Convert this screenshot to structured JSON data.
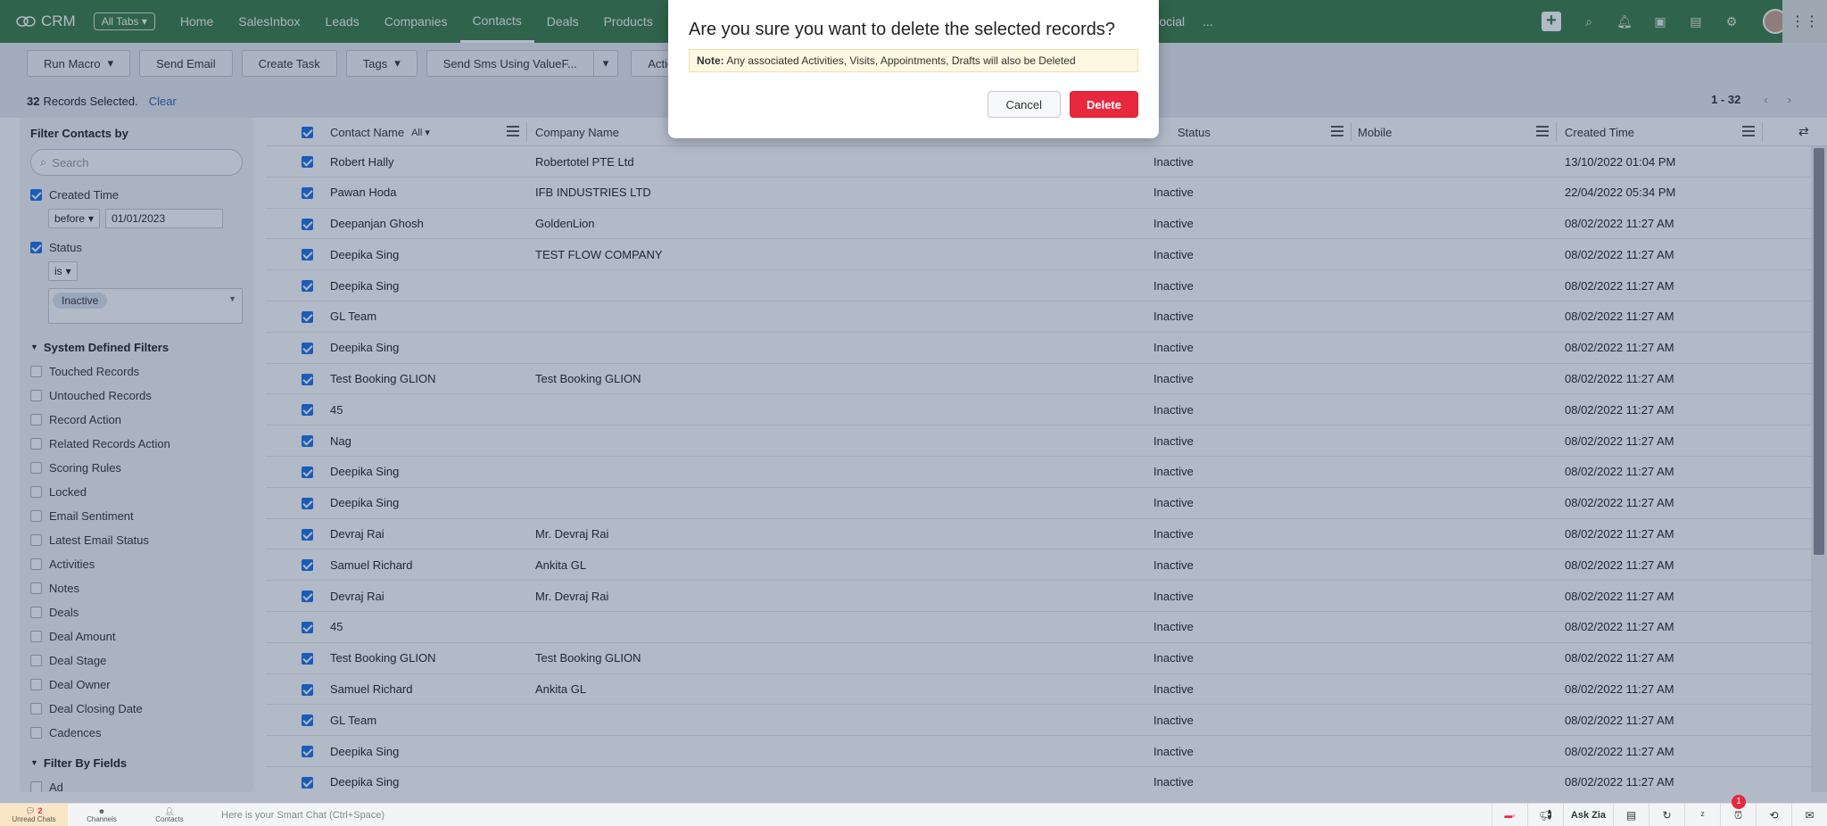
{
  "app": {
    "name": "CRM",
    "all_tabs": "All Tabs"
  },
  "nav": {
    "tabs": [
      "Home",
      "SalesInbox",
      "Leads",
      "Companies",
      "Contacts",
      "Deals",
      "Products"
    ],
    "active": "Contacts",
    "right_tabs": [
      "Social",
      "..."
    ]
  },
  "toolbar": {
    "run_macro": "Run Macro",
    "send_email": "Send Email",
    "create_task": "Create Task",
    "tags": "Tags",
    "send_sms": "Send Sms Using ValueF...",
    "actions": "Actio"
  },
  "records": {
    "count": "32",
    "selected_label": "Records Selected.",
    "clear": "Clear",
    "range": "1 - 32"
  },
  "sidebar": {
    "title": "Filter Contacts by",
    "search_placeholder": "Search",
    "created_time": {
      "label": "Created Time",
      "op": "before",
      "value": "01/01/2023"
    },
    "status": {
      "label": "Status",
      "op": "is",
      "value": "Inactive"
    },
    "system_filters_title": "System Defined Filters",
    "system_filters": [
      "Touched Records",
      "Untouched Records",
      "Record Action",
      "Related Records Action",
      "Scoring Rules",
      "Locked",
      "Email Sentiment",
      "Latest Email Status",
      "Activities",
      "Notes",
      "Deals",
      "Deal Amount",
      "Deal Stage",
      "Deal Owner",
      "Deal Closing Date",
      "Cadences"
    ],
    "filter_by_fields_title": "Filter By Fields",
    "filter_by_fields_first": "Ad"
  },
  "table": {
    "columns": {
      "contact_name": "Contact Name",
      "all": "All",
      "company_name": "Company Name",
      "status": "Status",
      "mobile": "Mobile",
      "created_time": "Created Time"
    },
    "rows": [
      {
        "name": "Robert Hally",
        "company": "Robertotel PTE Ltd",
        "status": "Inactive",
        "created": "13/10/2022 01:04 PM"
      },
      {
        "name": "Pawan Hoda",
        "company": "IFB INDUSTRIES LTD",
        "status": "Inactive",
        "created": "22/04/2022 05:34 PM"
      },
      {
        "name": "Deepanjan Ghosh",
        "company": "GoldenLion",
        "status": "Inactive",
        "created": "08/02/2022 11:27 AM"
      },
      {
        "name": "Deepika Sing",
        "company": "TEST FLOW COMPANY",
        "status": "Inactive",
        "created": "08/02/2022 11:27 AM"
      },
      {
        "name": "Deepika Sing",
        "company": "",
        "status": "Inactive",
        "created": "08/02/2022 11:27 AM"
      },
      {
        "name": "GL Team",
        "company": "",
        "status": "Inactive",
        "created": "08/02/2022 11:27 AM"
      },
      {
        "name": "Deepika Sing",
        "company": "",
        "status": "Inactive",
        "created": "08/02/2022 11:27 AM"
      },
      {
        "name": "Test Booking GLION",
        "company": "Test Booking GLION",
        "status": "Inactive",
        "created": "08/02/2022 11:27 AM"
      },
      {
        "name": "45",
        "company": "",
        "status": "Inactive",
        "created": "08/02/2022 11:27 AM"
      },
      {
        "name": "Nag",
        "company": "",
        "status": "Inactive",
        "created": "08/02/2022 11:27 AM"
      },
      {
        "name": "Deepika Sing",
        "company": "",
        "status": "Inactive",
        "created": "08/02/2022 11:27 AM"
      },
      {
        "name": "Deepika Sing",
        "company": "",
        "status": "Inactive",
        "created": "08/02/2022 11:27 AM"
      },
      {
        "name": "Devraj Rai",
        "company": "Mr. Devraj Rai",
        "status": "Inactive",
        "created": "08/02/2022 11:27 AM"
      },
      {
        "name": "Samuel Richard",
        "company": "Ankita GL",
        "status": "Inactive",
        "created": "08/02/2022 11:27 AM"
      },
      {
        "name": "Devraj Rai",
        "company": "Mr. Devraj Rai",
        "status": "Inactive",
        "created": "08/02/2022 11:27 AM"
      },
      {
        "name": "45",
        "company": "",
        "status": "Inactive",
        "created": "08/02/2022 11:27 AM"
      },
      {
        "name": "Test Booking GLION",
        "company": "Test Booking GLION",
        "status": "Inactive",
        "created": "08/02/2022 11:27 AM"
      },
      {
        "name": "Samuel Richard",
        "company": "Ankita GL",
        "status": "Inactive",
        "created": "08/02/2022 11:27 AM"
      },
      {
        "name": "GL Team",
        "company": "",
        "status": "Inactive",
        "created": "08/02/2022 11:27 AM"
      },
      {
        "name": "Deepika Sing",
        "company": "",
        "status": "Inactive",
        "created": "08/02/2022 11:27 AM"
      },
      {
        "name": "Deepika Sing",
        "company": "",
        "status": "Inactive",
        "created": "08/02/2022 11:27 AM"
      }
    ]
  },
  "dialog": {
    "title": "Are you sure you want to delete the selected records?",
    "note_label": "Note:",
    "note_text": "Any associated Activities, Visits, Appointments, Drafts will also be Deleted",
    "cancel": "Cancel",
    "delete": "Delete"
  },
  "bottombar": {
    "unread_chats": "Unread Chats",
    "unread_count": "2",
    "channels": "Channels",
    "contacts": "Contacts",
    "chat_placeholder": "Here is your Smart Chat (Ctrl+Space)",
    "ask_zia": "Ask Zia",
    "alarm_count": "1"
  },
  "colors": {
    "nav_green": "#3a7d44",
    "delete_red": "#e8283f",
    "checkbox_blue": "#1a73e8"
  }
}
